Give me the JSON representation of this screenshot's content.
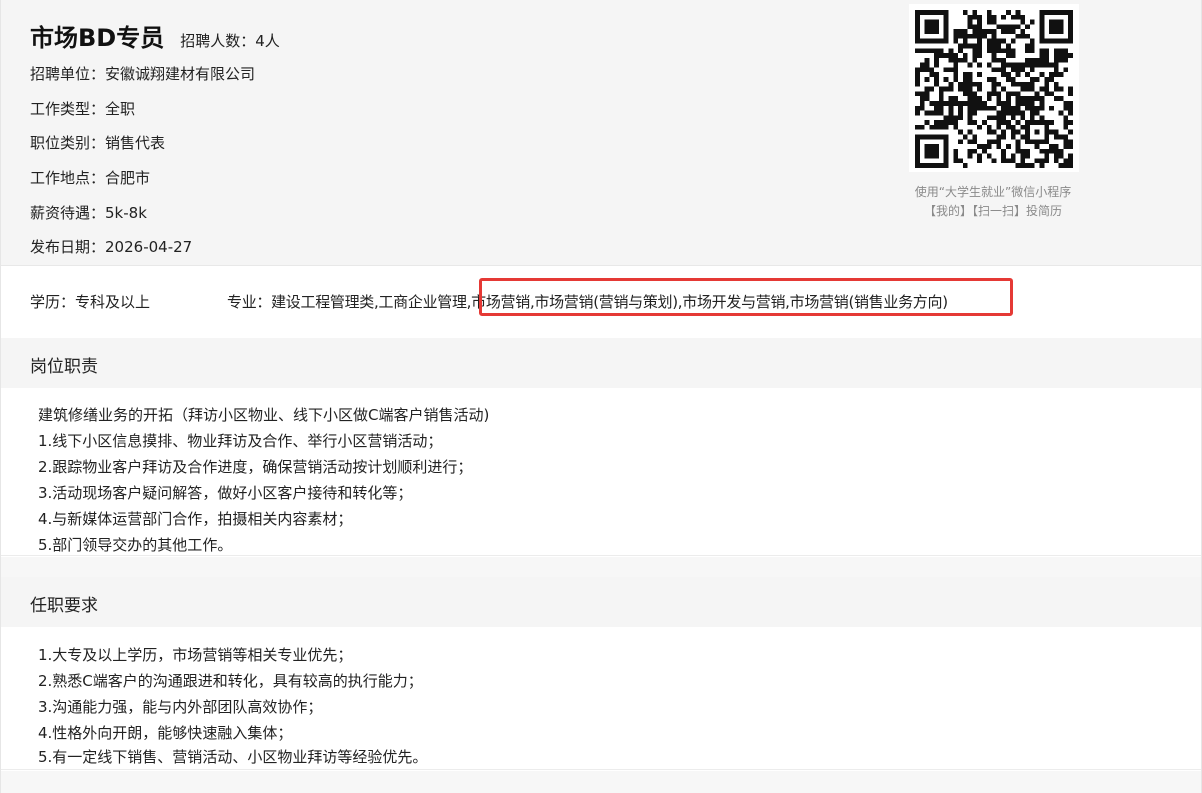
{
  "job": {
    "title": "市场BD专员",
    "headcount": "招聘人数：4人",
    "company_label": "招聘单位：",
    "company": "安徽诚翔建材有限公司",
    "type_label": "工作类型：",
    "type": "全职",
    "category_label": "职位类别：",
    "category": "销售代表",
    "location_label": "工作地点：",
    "location": "合肥市",
    "salary_label": "薪资待遇：",
    "salary": "5k-8k",
    "date_label": "发布日期：",
    "date": "2026-04-27"
  },
  "qr": {
    "note_line1": "使用“大学生就业”微信小程序",
    "note_line2": "【我的】【扫一扫】投简历"
  },
  "requirements": {
    "education": "学历：专科及以上",
    "major": "专业：建设工程管理类,工商企业管理,市场营销,市场营销(营销与策划),市场开发与营销,市场营销(销售业务方向)"
  },
  "duties": {
    "heading": "岗位职责",
    "lines": [
      "建筑修缮业务的开拓（拜访小区物业、线下小区做C端客户销售活动)",
      "1.线下小区信息摸排、物业拜访及合作、举行小区营销活动；",
      "2.跟踪物业客户拜访及合作进度，确保营销活动按计划顺利进行；",
      "3.活动现场客户疑问解答，做好小区客户接待和转化等；",
      "4.与新媒体运营部门合作，拍摄相关内容素材；",
      "5.部门领导交办的其他工作。"
    ]
  },
  "qualifications": {
    "heading": "任职要求",
    "lines": [
      "1.大专及以上学历，市场营销等相关专业优先；",
      "2.熟悉C端客户的沟通跟进和转化，具有较高的执行能力；",
      "3.沟通能力强，能与内外部团队高效协作；",
      "4.性格外向开朗，能够快速融入集体；",
      "5.有一定线下销售、营销活动、小区物业拜访等经验优先。"
    ]
  },
  "colors": {
    "highlight_border": "#e53935",
    "header_bg": "#f5f5f5"
  }
}
